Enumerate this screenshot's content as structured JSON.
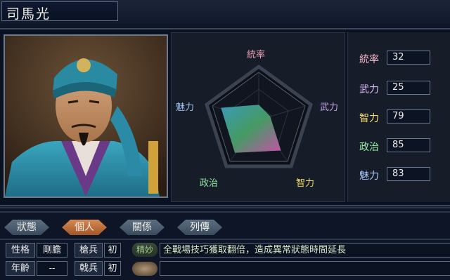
{
  "character": {
    "name": "司馬光"
  },
  "radar": {
    "labels": [
      {
        "key": "tonsotsu",
        "text": "統率",
        "color": "#e8a0b4"
      },
      {
        "key": "buryoku",
        "text": "武力",
        "color": "#c8a8f0"
      },
      {
        "key": "chiryoku",
        "text": "智力",
        "color": "#f0d86a"
      },
      {
        "key": "seiji",
        "text": "政治",
        "color": "#8fe8a0"
      },
      {
        "key": "miryoku",
        "text": "魅力",
        "color": "#a0c4f8"
      }
    ]
  },
  "stats": [
    {
      "label": "統率",
      "value": "32",
      "color": "#f4b6c8"
    },
    {
      "label": "武力",
      "value": "25",
      "color": "#d8b8f8"
    },
    {
      "label": "智力",
      "value": "79",
      "color": "#f6dc74"
    },
    {
      "label": "政治",
      "value": "85",
      "color": "#98f0a8"
    },
    {
      "label": "魅力",
      "value": "83",
      "color": "#a8c8fa"
    }
  ],
  "tabs": [
    {
      "label": "狀態",
      "active": false
    },
    {
      "label": "個人",
      "active": true
    },
    {
      "label": "關係",
      "active": false
    },
    {
      "label": "列傳",
      "active": false
    }
  ],
  "info": {
    "personality_label": "性格",
    "personality_value": "剛膽",
    "age_label": "年齡",
    "age_value": "--",
    "spear_label": "槍兵",
    "spear_value": "初",
    "halberd_label": "戟兵",
    "halberd_value": "初"
  },
  "skill": {
    "name": "精妙",
    "description": "全戰場技巧獲取翻倍，造成異常狀態時間延長"
  }
}
